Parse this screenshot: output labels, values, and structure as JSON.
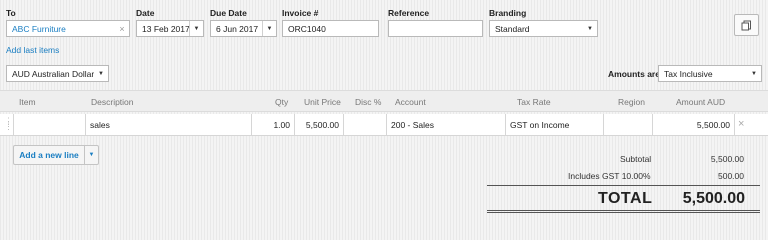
{
  "header": {
    "to_label": "To",
    "to_value": "ABC Furniture",
    "date_label": "Date",
    "date_value": "13 Feb 2017",
    "due_label": "Due Date",
    "due_value": "6 Jun 2017",
    "invoice_label": "Invoice #",
    "invoice_value": "ORC1040",
    "reference_label": "Reference",
    "reference_value": "",
    "branding_label": "Branding",
    "branding_value": "Standard",
    "add_last_items": "Add last items"
  },
  "currency": {
    "value": "AUD Australian Dollar"
  },
  "amounts": {
    "label": "Amounts are",
    "value": "Tax Inclusive"
  },
  "table": {
    "columns": [
      "Item",
      "Description",
      "Qty",
      "Unit Price",
      "Disc %",
      "Account",
      "Tax Rate",
      "Region",
      "Amount AUD"
    ],
    "row": {
      "item": "",
      "description": "sales",
      "qty": "1.00",
      "unit_price": "5,500.00",
      "disc": "",
      "account": "200 - Sales",
      "tax_rate": "GST on Income",
      "region": "",
      "amount": "5,500.00"
    }
  },
  "add_line": {
    "label": "Add a new line"
  },
  "totals": {
    "subtotal_label": "Subtotal",
    "subtotal_value": "5,500.00",
    "gst_label": "Includes GST 10.00%",
    "gst_value": "500.00",
    "total_label": "TOTAL",
    "total_value": "5,500.00"
  },
  "icons": {
    "copy": "copy-icon",
    "clear": "clear-x-icon",
    "drag": "drag-handle-icon",
    "delete": "delete-row-icon",
    "dropdown": "chevron-down-icon"
  },
  "colors": {
    "link": "#1a7ec2",
    "button_text": "#1a7ec2"
  }
}
